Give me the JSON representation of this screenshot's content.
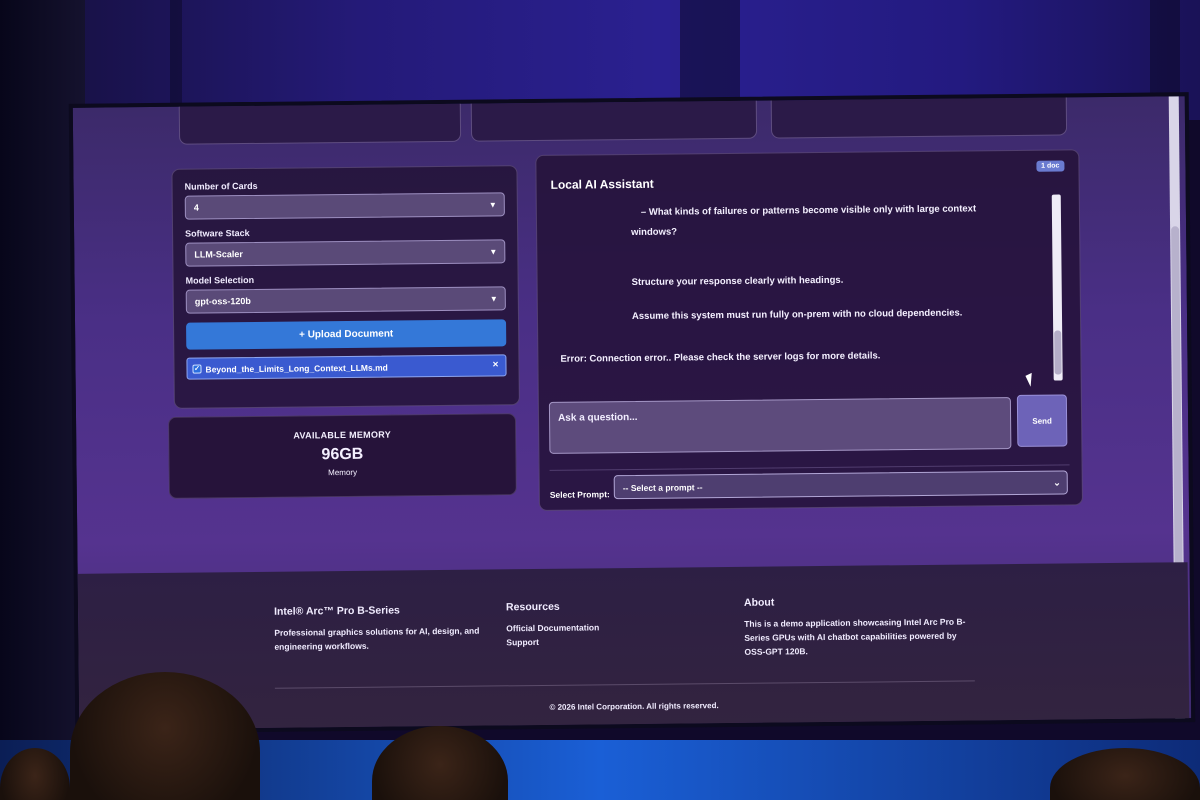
{
  "config": {
    "cards_label": "Number of Cards",
    "cards_value": "4",
    "stack_label": "Software Stack",
    "stack_value": "LLM-Scaler",
    "model_label": "Model Selection",
    "model_value": "gpt-oss-120b",
    "upload_label": "+ Upload Document",
    "file_name": "Beyond_the_Limits_Long_Context_LLMs.md",
    "file_remove": "×"
  },
  "memory": {
    "label": "AVAILABLE MEMORY",
    "value": "96GB",
    "sub": "Memory"
  },
  "chat": {
    "title": "Local AI Assistant",
    "doc_badge": "1 doc",
    "line1": "– What kinds of failures or patterns become visible only with large context",
    "line2": "windows?",
    "line3": "Structure your response clearly with headings.",
    "line4": "Assume this system must run fully on-prem with no cloud dependencies.",
    "error": "Error: Connection error.. Please check the server logs for more details.",
    "input_placeholder": "Ask a question...",
    "send_label": "Send",
    "prompt_label": "Select Prompt:",
    "prompt_value": "-- Select a prompt --"
  },
  "footer": {
    "col1_title": "Intel® Arc™ Pro B-Series",
    "col1_text": "Professional graphics solutions for AI, design, and engineering workflows.",
    "col2_title": "Resources",
    "col2_link1": "Official Documentation",
    "col2_link2": "Support",
    "col3_title": "About",
    "col3_text": "This is a demo application showcasing Intel Arc Pro B-Series GPUs with AI chatbot capabilities powered by OSS-GPT 120B.",
    "copyright": "© 2026 Intel Corporation. All rights reserved."
  }
}
